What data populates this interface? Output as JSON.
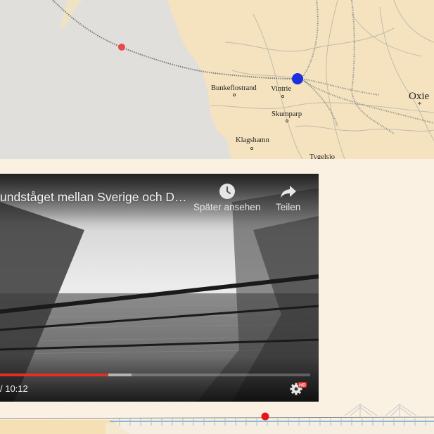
{
  "map": {
    "places": [
      {
        "name": "Bunkeflostrand"
      },
      {
        "name": "Vintrie"
      },
      {
        "name": "Skumparp"
      },
      {
        "name": "Klagshamn"
      },
      {
        "name": "Tygelsjo",
        "display": "Tygelsjo"
      },
      {
        "name": "Oxie"
      }
    ],
    "colors": {
      "current_position": "#1e2fe0",
      "waypoint": "#e84a4a",
      "land": "#f5e4c0",
      "sea": "#e3e0dc"
    }
  },
  "video": {
    "title": "undståget mellan Sverige och D…",
    "watch_later_label": "Später ansehen",
    "share_label": "Teilen",
    "time_label": "/ 10:12",
    "progress_fraction": 0.35,
    "buffered_fraction": 0.425,
    "icons": {
      "watch_later": "clock-icon",
      "share": "share-arrow-icon",
      "settings": "gear-hd-icon"
    },
    "settings_badge": "HD",
    "accent_color": "#e52d27"
  },
  "profile": {
    "marker_color": "#e8141c"
  }
}
